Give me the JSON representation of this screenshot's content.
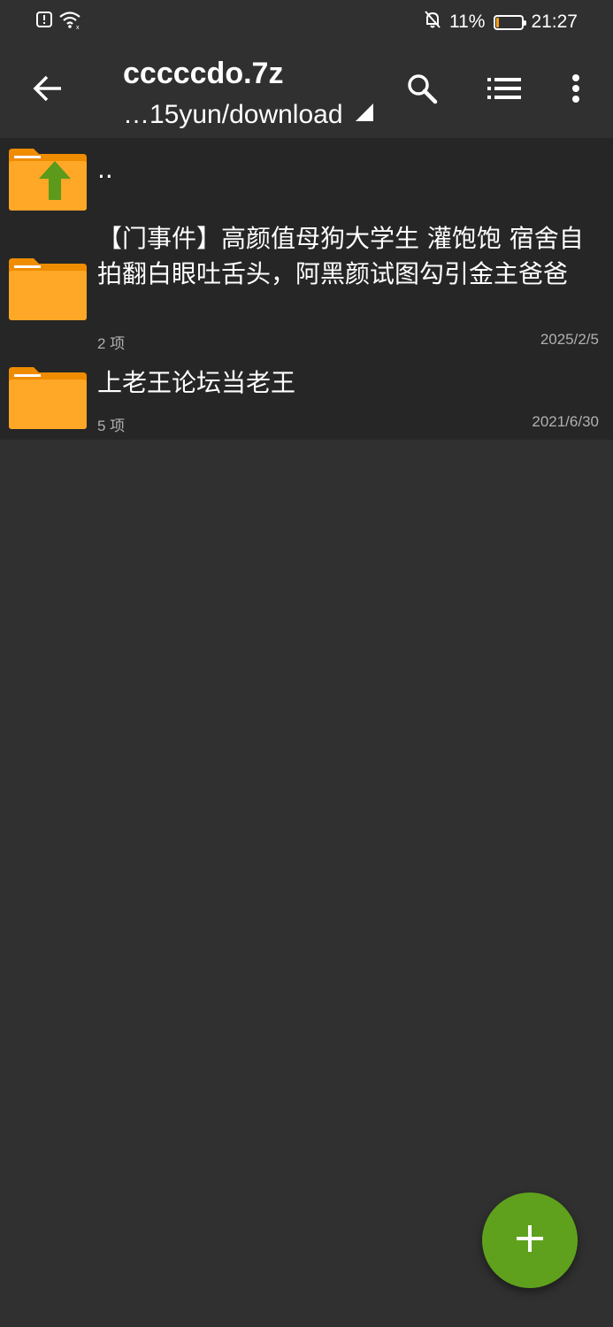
{
  "status_bar": {
    "battery_percent_text": "11%",
    "battery_level": 0.11,
    "time": "21:27",
    "icons": [
      "alert-icon",
      "wifi-icon",
      "bell-off-icon",
      "battery-icon"
    ]
  },
  "app_bar": {
    "title": "cccccdo.7z",
    "path": "…15yun/download",
    "icons": [
      "back-arrow-icon",
      "search-icon",
      "list-view-icon",
      "more-vert-icon"
    ]
  },
  "files": [
    {
      "name": "..",
      "count": "",
      "date": "",
      "icon": "folder-up-icon"
    },
    {
      "name": "【门事件】高颜值母狗大学生 灌饱饱 宿舍自拍翻白眼吐舌头，阿黑颜试图勾引金主爸爸",
      "count": "2 项",
      "date": "2025/2/5",
      "icon": "folder-icon"
    },
    {
      "name": "上老王论坛当老王",
      "count": "5 项",
      "date": "2021/6/30",
      "icon": "folder-icon"
    }
  ],
  "fab": {
    "icon": "plus-icon"
  },
  "colors": {
    "background": "#303030",
    "list_background": "#262626",
    "folder": "#ffa726",
    "folder_tab": "#f08c00",
    "up_arrow": "#5b9a1a",
    "fab": "#5fa11d"
  }
}
